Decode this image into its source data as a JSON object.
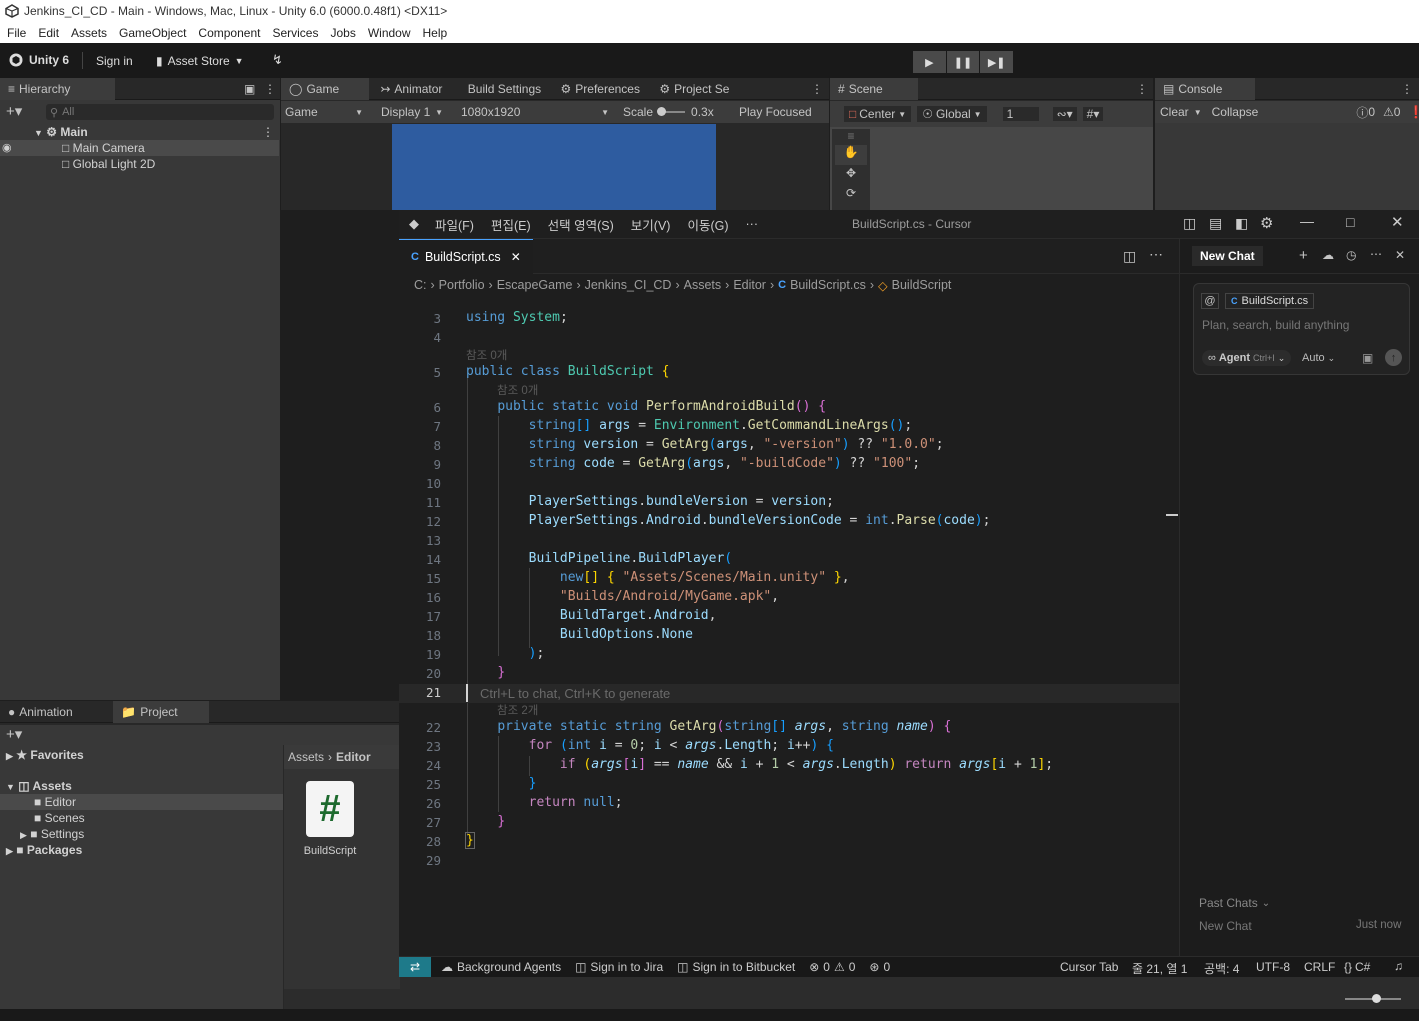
{
  "unity": {
    "window_title": "Jenkins_CI_CD - Main - Windows, Mac, Linux - Unity 6.0 (6000.0.48f1) <DX11>",
    "menu": [
      "File",
      "Edit",
      "Assets",
      "GameObject",
      "Component",
      "Services",
      "Jobs",
      "Window",
      "Help"
    ],
    "toolbar": {
      "version": "Unity 6",
      "signin": "Sign in",
      "asset_store": "Asset Store"
    },
    "hierarchy": {
      "tab": "Hierarchy",
      "search_placeholder": "All",
      "scene": "Main",
      "items": [
        "Main Camera",
        "Global Light 2D"
      ]
    },
    "game": {
      "tab": "Game",
      "mode": "Game",
      "display": "Display 1",
      "resolution": "1080x1920",
      "scale_label": "Scale",
      "scale_value": "0.3x",
      "play_mode": "Play Focused"
    },
    "other_tabs": {
      "animator": "Animator",
      "build_settings": "Build Settings",
      "preferences": "Preferences",
      "project_settings": "Project Se"
    },
    "scene": {
      "tab": "Scene",
      "pivot": "Center",
      "space": "Global",
      "grid_value": "1"
    },
    "console": {
      "tab": "Console",
      "clear": "Clear",
      "collapse": "Collapse",
      "log_count": "0",
      "warn_count": "0",
      "error_count": "0"
    },
    "bottom_tabs": {
      "animation": "Animation",
      "project": "Project"
    },
    "project": {
      "favorites": "Favorites",
      "assets": "Assets",
      "folders": [
        "Editor",
        "Scenes",
        "Settings"
      ],
      "packages": "Packages",
      "path_root": "Assets",
      "path_current": "Editor",
      "file_label": "BuildScript"
    }
  },
  "cursor": {
    "menu": [
      "파일(F)",
      "편집(E)",
      "선택 영역(S)",
      "보기(V)",
      "이동(G)",
      "···"
    ],
    "title": "BuildScript.cs - Cursor",
    "file_tab": "BuildScript.cs",
    "breadcrumb": [
      "C:",
      "Portfolio",
      "EscapeGame",
      "Jenkins_CI_CD",
      "Assets",
      "Editor",
      "BuildScript.cs",
      "BuildScript"
    ],
    "ref0": "참조 0개",
    "ref2": "참조 2개",
    "inline_hint": "Ctrl+L to chat, Ctrl+K to generate",
    "line_numbers": [
      "3",
      "4",
      "5",
      "6",
      "7",
      "8",
      "9",
      "10",
      "11",
      "12",
      "13",
      "14",
      "15",
      "16",
      "17",
      "18",
      "19",
      "20",
      "21",
      "22",
      "23",
      "24",
      "25",
      "26",
      "27",
      "28",
      "29"
    ],
    "chat": {
      "tab": "New Chat",
      "context_chip": "BuildScript.cs",
      "placeholder": "Plan, search, build anything",
      "agent": "Agent",
      "agent_shortcut": "Ctrl+I",
      "model": "Auto",
      "past_chats": "Past Chats",
      "history_item": "New Chat",
      "history_time": "Just now"
    },
    "status": {
      "bg_agents": "Background Agents",
      "jira": "Sign in to Jira",
      "bitbucket": "Sign in to Bitbucket",
      "errors": "0",
      "warnings": "0",
      "ports": "0",
      "cursor_tab": "Cursor Tab",
      "position": "줄 21, 열 1",
      "spaces": "공백: 4",
      "encoding": "UTF-8",
      "eol": "CRLF",
      "language": "C#"
    }
  }
}
